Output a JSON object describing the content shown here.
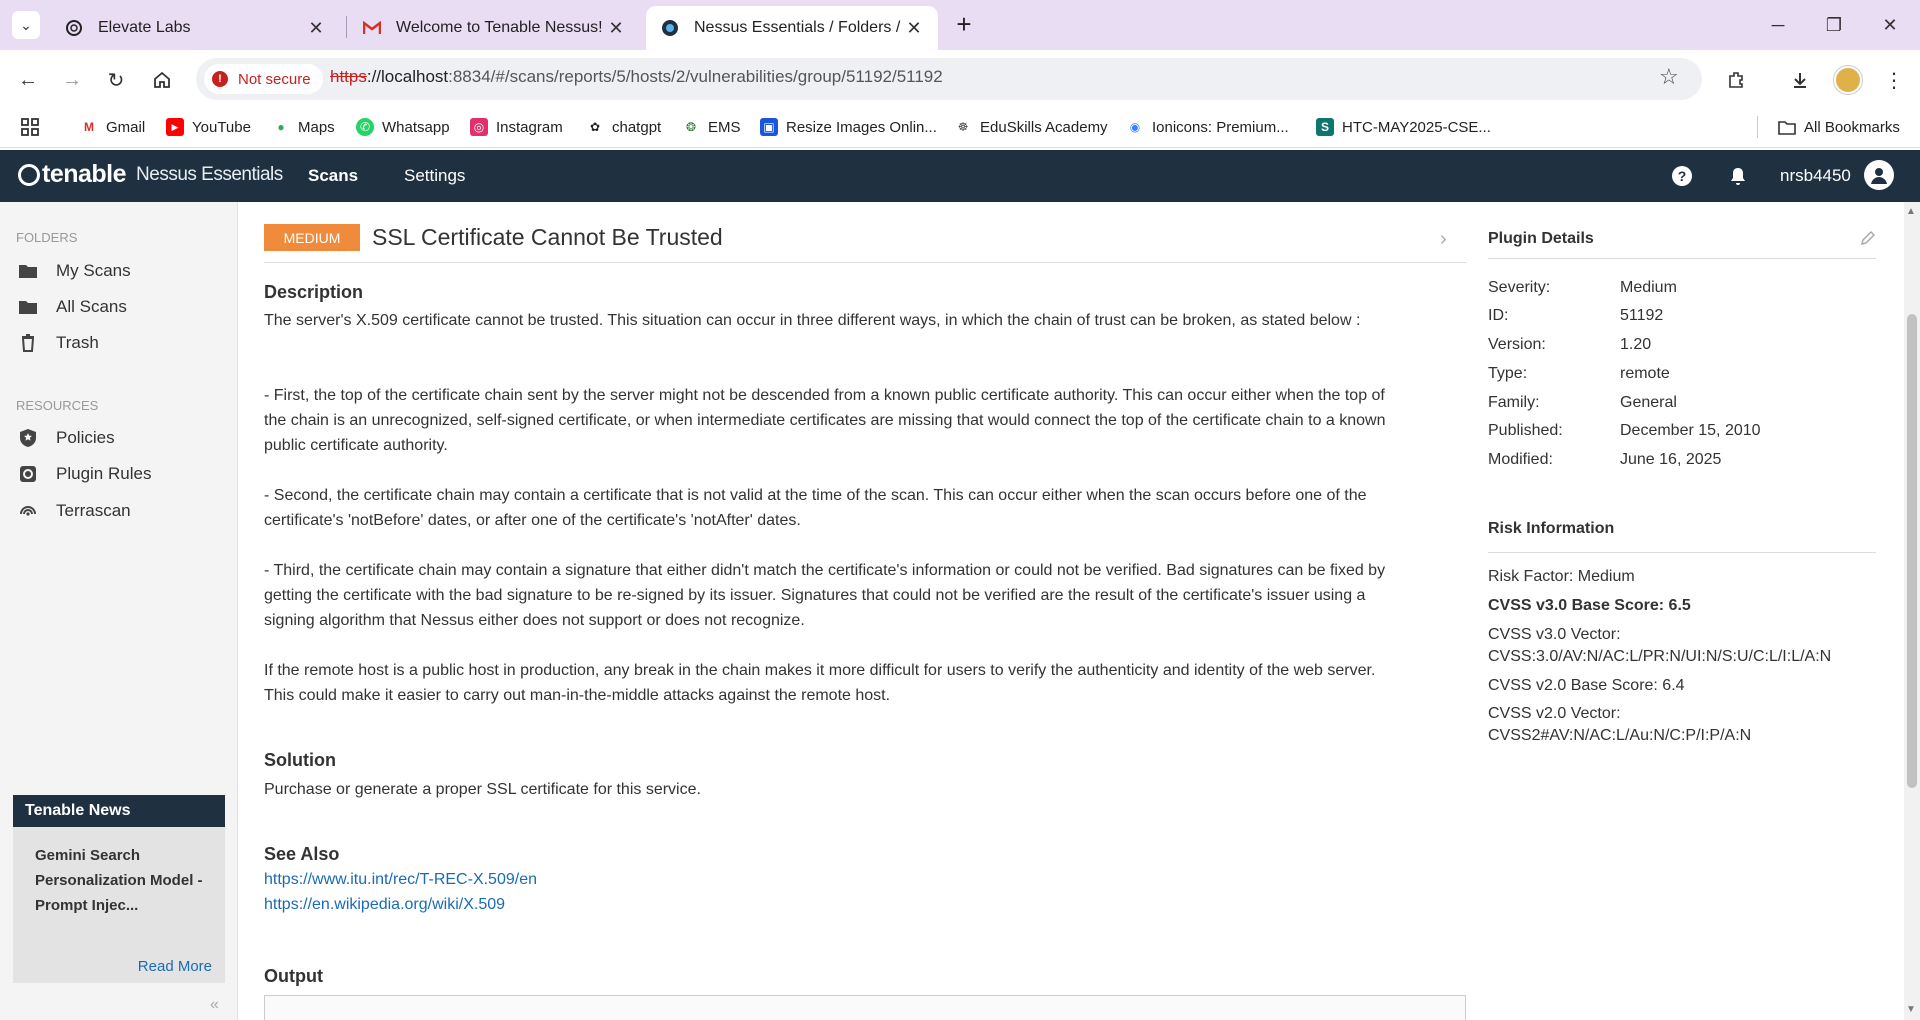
{
  "browser": {
    "tabs": [
      {
        "title": "Elevate Labs",
        "close": "✕"
      },
      {
        "title": "Welcome to Tenable Nessus! - r",
        "close": "✕"
      },
      {
        "title": "Nessus Essentials / Folders / Vie",
        "close": "✕"
      }
    ],
    "security_chip": "Not secure",
    "url_scheme": "https",
    "url_host": "://localhost",
    "url_rest": ":8834/#/scans/reports/5/hosts/2/vulnerabilities/group/51192/51192",
    "bookmarks": [
      "Gmail",
      "YouTube",
      "Maps",
      "Whatsapp",
      "Instagram",
      "chatgpt",
      "EMS",
      "Resize Images Onlin...",
      "EduSkills Academy",
      "Ionicons: Premium...",
      "HTC-MAY2025-CSE..."
    ],
    "all_bookmarks": "All Bookmarks"
  },
  "app": {
    "brand": "tenable",
    "product": "Nessus Essentials",
    "nav": [
      "Scans",
      "Settings"
    ],
    "user": "nrsb4450"
  },
  "sidebar": {
    "folders_label": "FOLDERS",
    "folders": [
      "My Scans",
      "All Scans",
      "Trash"
    ],
    "resources_label": "RESOURCES",
    "resources": [
      "Policies",
      "Plugin Rules",
      "Terrascan"
    ],
    "news": {
      "title": "Tenable News",
      "headline": "Gemini Search Personalization Model - Prompt Injec...",
      "read_more": "Read More"
    }
  },
  "vuln": {
    "severity": "MEDIUM",
    "title": "SSL Certificate Cannot Be Trusted",
    "description_heading": "Description",
    "description": [
      "The server's X.509 certificate cannot be trusted. This situation can occur in three different ways, in which the chain of trust can be broken, as stated below :",
      "- First, the top of the certificate chain sent by the server might not be descended from a known public certificate authority. This can occur either when the top of the chain is an unrecognized, self-signed certificate, or when intermediate certificates are missing that would connect the top of the certificate chain to a known public certificate authority.",
      "- Second, the certificate chain may contain a certificate that is not valid at the time of the scan. This can occur either when the scan occurs before one of the certificate's 'notBefore' dates, or after one of the certificate's 'notAfter' dates.",
      "- Third, the certificate chain may contain a signature that either didn't match the certificate's information or could not be verified. Bad signatures can be fixed by getting the certificate with the bad signature to be re-signed by its issuer. Signatures that could not be verified are the result of the certificate's issuer using a signing algorithm that Nessus either does not support or does not recognize.",
      "If the remote host is a public host in production, any break in the chain makes it more difficult for users to verify the authenticity and identity of the web server. This could make it easier to carry out man-in-the-middle attacks against the remote host."
    ],
    "solution_heading": "Solution",
    "solution": "Purchase or generate a proper SSL certificate for this service.",
    "see_also_heading": "See Also",
    "see_also": [
      "https://www.itu.int/rec/T-REC-X.509/en",
      "https://en.wikipedia.org/wiki/X.509"
    ],
    "output_heading": "Output"
  },
  "plugin_details": {
    "heading": "Plugin Details",
    "rows": [
      {
        "label": "Severity:",
        "value": "Medium"
      },
      {
        "label": "ID:",
        "value": "51192"
      },
      {
        "label": "Version:",
        "value": "1.20"
      },
      {
        "label": "Type:",
        "value": "remote"
      },
      {
        "label": "Family:",
        "value": "General"
      },
      {
        "label": "Published:",
        "value": "December 15, 2010"
      },
      {
        "label": "Modified:",
        "value": "June 16, 2025"
      }
    ]
  },
  "risk_info": {
    "heading": "Risk Information",
    "risk_factor": "Risk Factor: Medium",
    "cvss3_base": "CVSS v3.0 Base Score: 6.5",
    "cvss3_vector_label": "CVSS v3.0 Vector:",
    "cvss3_vector": "CVSS:3.0/AV:N/AC:L/PR:N/UI:N/S:U/C:L/I:L/A:N",
    "cvss2_base": "CVSS v2.0 Base Score: 6.4",
    "cvss2_vector_label": "CVSS v2.0 Vector:",
    "cvss2_vector": "CVSS2#AV:N/AC:L/Au:N/C:P/I:P/A:N"
  },
  "colors": {
    "header_bg": "#1f3140",
    "severity_medium": "#f08b3b",
    "link": "#1a6bb5"
  }
}
